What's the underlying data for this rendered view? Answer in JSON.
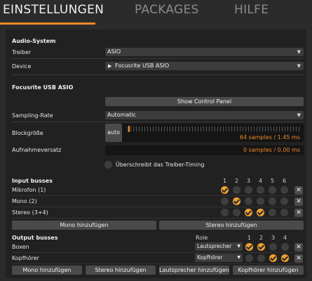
{
  "tabs": [
    {
      "label": "EINSTELLUNGEN"
    },
    {
      "label": "PACKAGES"
    },
    {
      "label": "HILFE"
    }
  ],
  "audio_system": {
    "title": "Audio-System",
    "driver_label": "Treiber",
    "driver_value": "ASIO",
    "device_label": "Device",
    "device_value": "Focusrite USB ASIO"
  },
  "device_section": {
    "title": "Focusrite USB ASIO",
    "control_panel_button": "Show Control Panel",
    "sampling_rate_label": "Sampling-Rate",
    "sampling_rate_value": "Automatic",
    "block_size_label": "Blockgröße",
    "block_size_auto": "auto",
    "block_size_readout": "64 samples / 1.45 ms",
    "latency_label": "Aufnahmeversatz",
    "latency_readout": "0 samples / 0.00 ms",
    "override_checkbox_label": "Überschreibt das Treiber-Timing"
  },
  "input_busses": {
    "title": "Input busses",
    "columns": [
      "1",
      "2",
      "3",
      "4",
      "5",
      "6"
    ],
    "rows": [
      {
        "name": "Mikrofon (1)",
        "active": [
          true,
          false,
          false,
          false,
          false,
          false
        ]
      },
      {
        "name": "Mono (2)",
        "active": [
          false,
          true,
          false,
          false,
          false,
          false
        ]
      },
      {
        "name": "Stereo (3+4)",
        "active": [
          false,
          false,
          true,
          true,
          false,
          false
        ]
      }
    ],
    "add_mono": "Mono hinzufügen",
    "add_stereo": "Stereo hinzufügen"
  },
  "output_busses": {
    "title": "Output busses",
    "role_header": "Role",
    "columns": [
      "1",
      "2",
      "3",
      "4"
    ],
    "rows": [
      {
        "name": "Boxen",
        "role": "Lautsprecher",
        "active": [
          true,
          true,
          false,
          false
        ]
      },
      {
        "name": "Kopfhörer",
        "role": "Kopfhörer",
        "active": [
          false,
          false,
          true,
          true
        ]
      }
    ],
    "add_mono": "Mono hinzufügen",
    "add_stereo": "Stereo hinzufügen",
    "add_speaker": "Lautsprecher hinzufügen",
    "add_headphones": "Kopfhörer hinzufügen"
  },
  "colors": {
    "accent": "#f08a24",
    "background": "#2b2b2b",
    "panel": "#212121"
  },
  "icons": {
    "dropdown": "chevron-down-icon",
    "device": "play-icon",
    "remove": "close-icon",
    "check": "checkmark-icon"
  }
}
